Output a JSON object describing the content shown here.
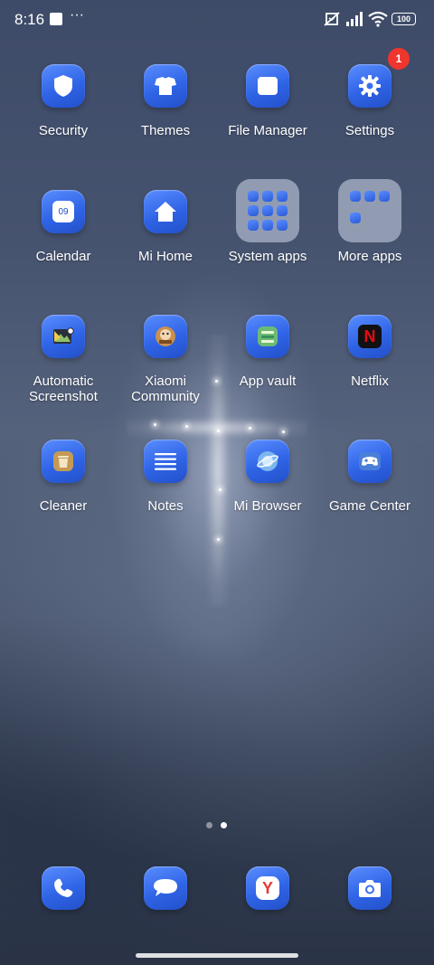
{
  "status_bar": {
    "time": "8:16",
    "battery_level": "100"
  },
  "apps": [
    {
      "label": "Security",
      "icon": "shield-icon"
    },
    {
      "label": "Themes",
      "icon": "themes-icon"
    },
    {
      "label": "File Manager",
      "icon": "folder-icon"
    },
    {
      "label": "Settings",
      "icon": "gear-icon",
      "badge": "1"
    },
    {
      "label": "Calendar",
      "icon": "calendar-icon",
      "icon_text": "09"
    },
    {
      "label": "Mi Home",
      "icon": "home-icon"
    },
    {
      "label": "System apps",
      "icon": "folder-grid-icon"
    },
    {
      "label": "More apps",
      "icon": "folder-grid-icon"
    },
    {
      "label": "Automatic Screenshot",
      "icon": "screenshot-icon"
    },
    {
      "label": "Xiaomi Community",
      "icon": "community-icon"
    },
    {
      "label": "App vault",
      "icon": "app-vault-icon"
    },
    {
      "label": "Netflix",
      "icon": "netflix-icon",
      "icon_text": "N"
    },
    {
      "label": "Cleaner",
      "icon": "trash-icon"
    },
    {
      "label": "Notes",
      "icon": "notes-icon"
    },
    {
      "label": "Mi Browser",
      "icon": "browser-icon"
    },
    {
      "label": "Game Center",
      "icon": "gamepad-icon"
    }
  ],
  "page_indicator": {
    "current_page": 2,
    "total_pages": 2
  },
  "dock": [
    {
      "icon": "phone-icon"
    },
    {
      "icon": "messages-icon"
    },
    {
      "icon": "yandex-browser-icon",
      "icon_text": "Y"
    },
    {
      "icon": "camera-icon"
    }
  ],
  "colors": {
    "accent_blue": "#3a6ff0",
    "badge_red": "#f0352c",
    "netflix_red": "#e50914"
  }
}
